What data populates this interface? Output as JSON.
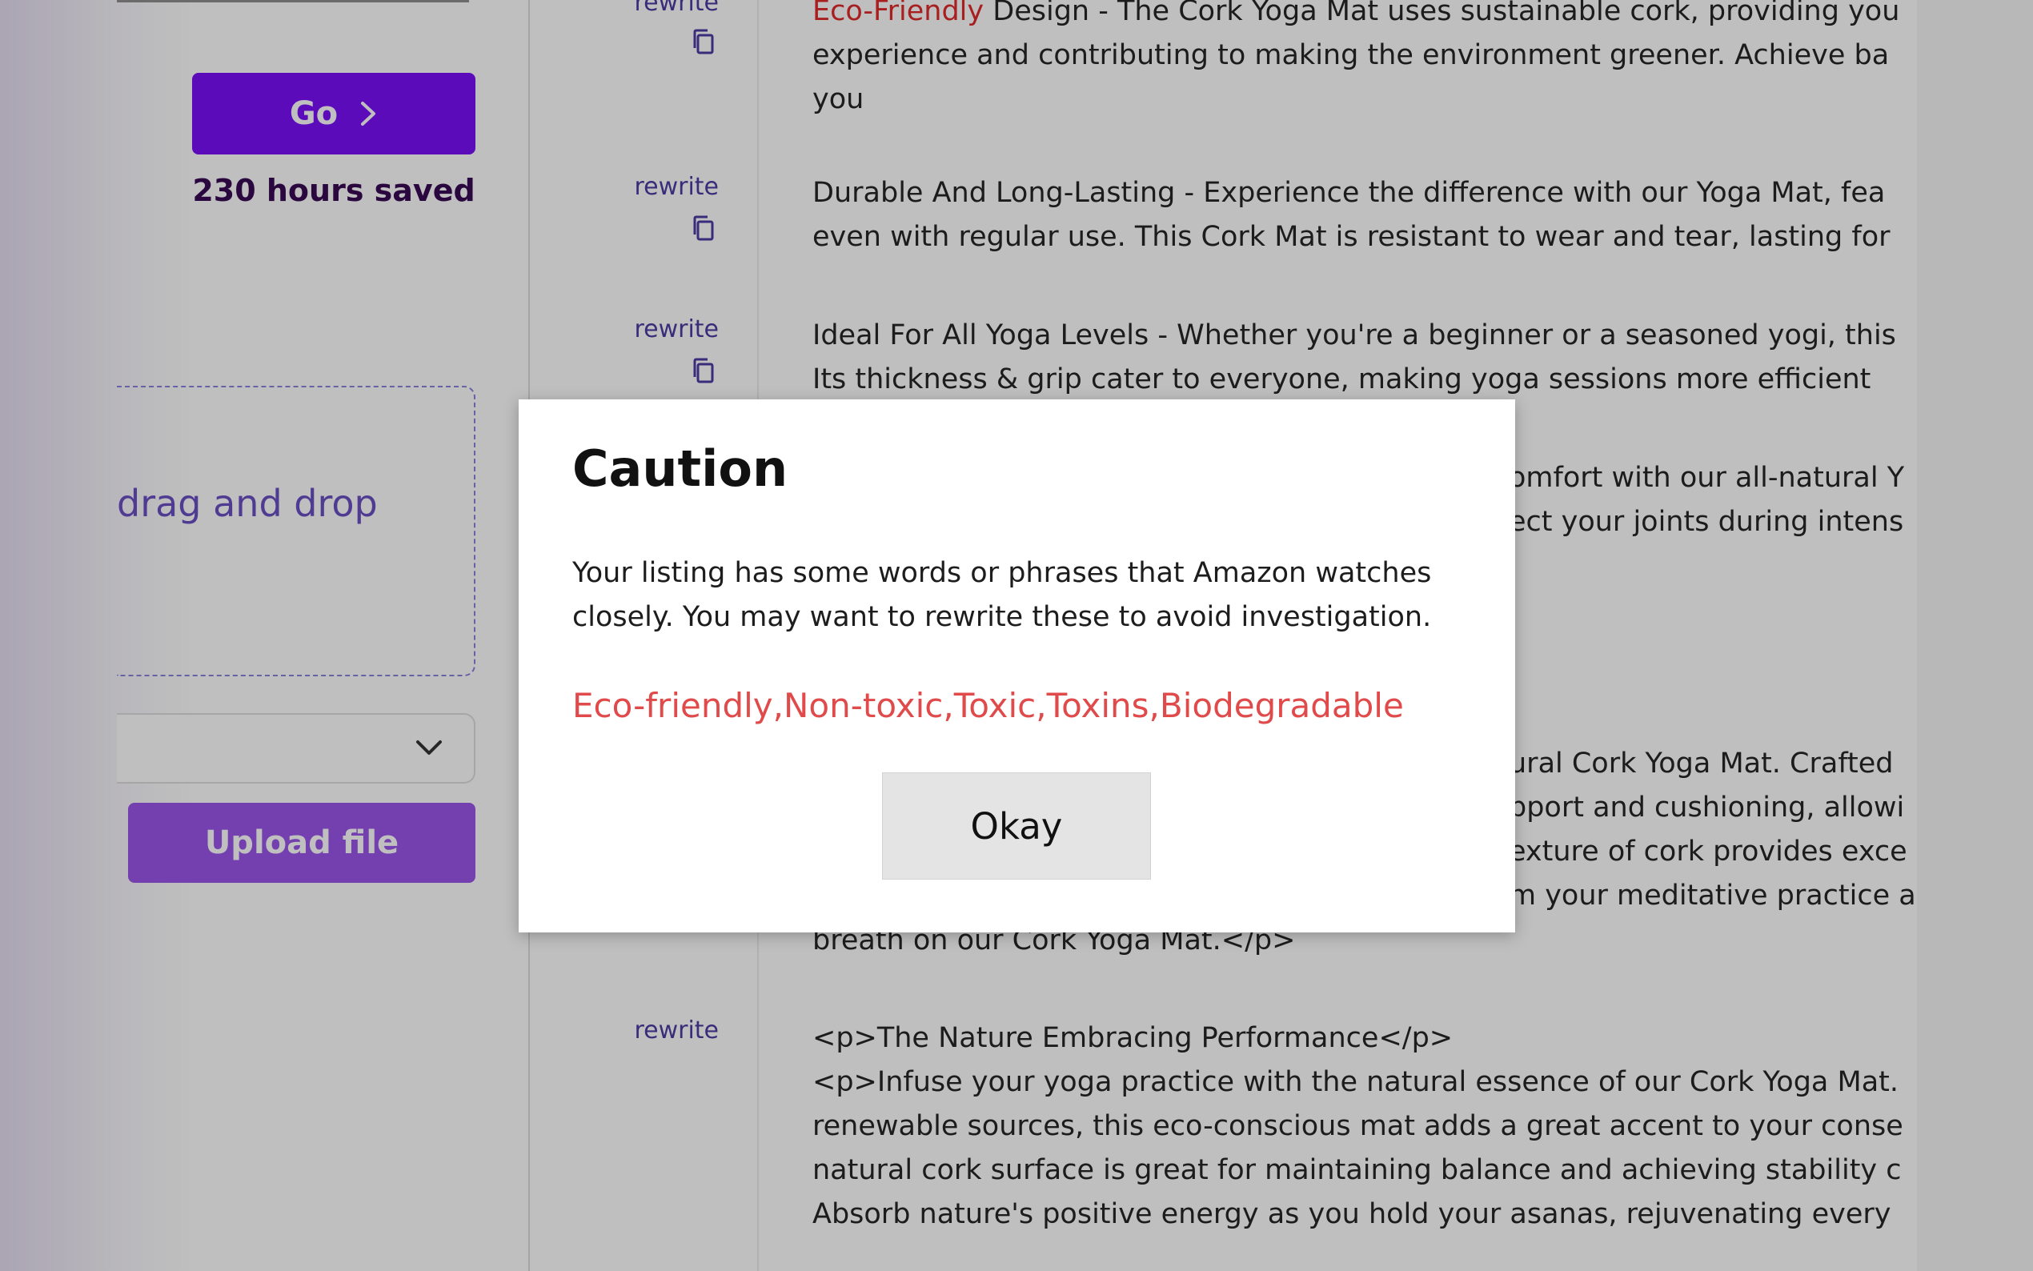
{
  "sidebar": {
    "go_label": "Go",
    "hours_saved": "230 hours saved",
    "dropzone_text": "drag and drop",
    "upload_label": "Upload file"
  },
  "main": {
    "rewrite_label": "rewrite",
    "paragraphs": [
      {
        "flagged": "Eco-Friendly",
        "line1_rest": " Design - The Cork Yoga Mat uses sustainable cork, providing you",
        "line2": "experience and contributing to making the environment greener. Achieve ba",
        "line3": "you"
      },
      {
        "line1": "Durable And Long-Lasting - Experience the difference with our Yoga Mat, fea",
        "line2": "even with regular use. This Cork Mat is resistant to wear and tear, lasting for"
      },
      {
        "line1": "Ideal For All Yoga Levels - Whether you're a beginner or a seasoned yogi, this",
        "line2": "Its thickness & grip cater to everyone, making yoga sessions more efficient"
      },
      {
        "line1": "omfort with our all-natural Y",
        "line2": "ect your joints during intens"
      },
      {
        "line1": "ural Cork Yoga Mat. Crafted",
        "line2": "pport and cushioning, allowi",
        "line3": "exture of cork provides exce",
        "line4": "m your meditative practice a",
        "line5": "breath on our Cork Yoga Mat.</p>"
      },
      {
        "line1": "<p>The Nature Embracing Performance</p>",
        "line2": "<p>Infuse your yoga practice with the natural essence of our Cork Yoga Mat.",
        "line3": "renewable sources, this eco-conscious mat adds a great accent to your conse",
        "line4": "natural cork surface is great for maintaining balance and achieving stability c",
        "line5": "Absorb nature's positive energy as you hold your asanas, rejuvenating every"
      }
    ]
  },
  "modal": {
    "title": "Caution",
    "body": "Your listing has some words or phrases that Amazon watches closely. You may want to rewrite these to avoid investigation.",
    "flagged_words": "Eco-friendly,Non-toxic,Toxic,Toxins,Biodegradable",
    "okay_label": "Okay"
  },
  "colors": {
    "go_button": "#7a0ff7",
    "upload_button": "#9b55ea",
    "flag_red": "#e02a2a",
    "warning_words": "#e04a4a",
    "rewrite_link": "#4e3ba3"
  },
  "icons": [
    "chevron-right-icon",
    "chevron-down-icon",
    "copy-icon"
  ]
}
